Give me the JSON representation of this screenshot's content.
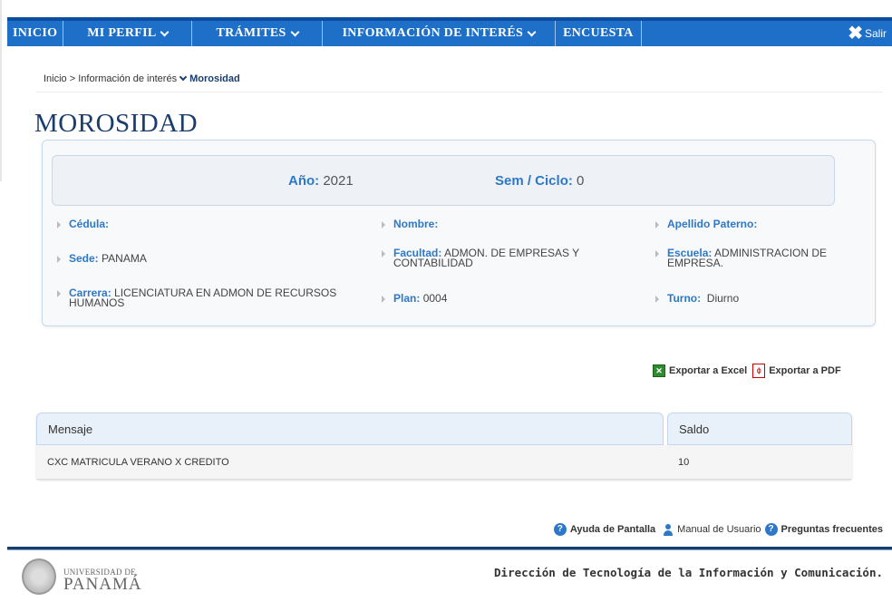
{
  "nav": {
    "inicio": "INICIO",
    "perfil": "MI PERFIL",
    "tramites": "TRÁMITES",
    "info": "INFORMACIÓN DE INTERÉS",
    "encuesta": "ENCUESTA",
    "salir": "Salir"
  },
  "breadcrumb": {
    "home": "Inicio",
    "sep": " > ",
    "parent": "Información de interés",
    "current": "Morosidad"
  },
  "page_title": "MOROSIDAD",
  "summary": {
    "ano_label": "Año:",
    "ano_value": "2021",
    "sem_label": "Sem / Ciclo:",
    "sem_value": "0"
  },
  "fields": {
    "cedula_label": "Cédula:",
    "cedula_value": "",
    "nombre_label": "Nombre:",
    "nombre_value": "",
    "apellido_label": "Apellido Paterno:",
    "apellido_value": "",
    "sede_label": "Sede:",
    "sede_value": "PANAMA",
    "facultad_label": "Facultad:",
    "facultad_value": "ADMON. DE EMPRESAS Y CONTABILIDAD",
    "escuela_label": "Escuela:",
    "escuela_value": "ADMINISTRACION DE EMPRESA.",
    "carrera_label": "Carrera:",
    "carrera_value": "LICENCIATURA EN ADMON DE RECURSOS HUMANOS",
    "plan_label": "Plan:",
    "plan_value": "0004",
    "turno_label": "Turno:",
    "turno_value": "Diurno"
  },
  "exports": {
    "excel": "Exportar a Excel",
    "pdf": "Exportar a PDF"
  },
  "table": {
    "headers": [
      "Mensaje",
      "Saldo"
    ],
    "rows": [
      [
        "CXC MATRICULA VERANO X CREDITO",
        "10"
      ]
    ]
  },
  "help": {
    "ayuda": "Ayuda de Pantalla",
    "manual": "Manual de Usuario",
    "preguntas": "Preguntas frecuentes"
  },
  "footer": {
    "uni_line1": "UNIVERSIDAD DE",
    "uni_line2": "PANAMÁ",
    "dtic": "Dirección de Tecnología de la Información y Comunicación."
  }
}
